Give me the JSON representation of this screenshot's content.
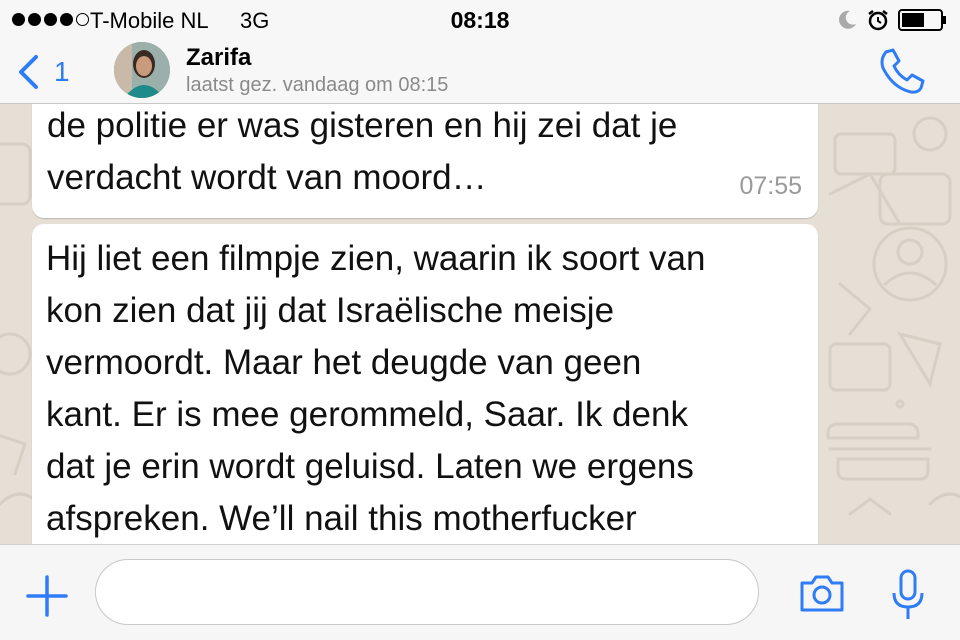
{
  "status_bar": {
    "signal_bars": 4,
    "signal_total": 5,
    "carrier": "T-Mobile NL",
    "network": "3G",
    "time": "08:18",
    "icons": [
      "moon-icon",
      "alarm-icon",
      "battery-icon"
    ]
  },
  "header": {
    "back_count": "1",
    "contact_name": "Zarifa",
    "last_seen": "laatst gez. vandaag om 08:15",
    "icons": [
      "chevron-left-icon",
      "avatar",
      "phone-icon"
    ]
  },
  "messages": [
    {
      "lines": [
        "de politie er was gisteren en hij zei dat je",
        "verdacht wordt van moord…"
      ],
      "time": "07:55"
    },
    {
      "lines": [
        "Hij liet een filmpje zien, waarin ik soort van",
        "kon zien dat jij dat Israëlische meisje",
        "vermoordt. Maar het deugde van geen",
        "kant. Er is mee gerommeld, Saar. Ik denk",
        "dat je erin wordt geluisd. Laten we ergens",
        "afspreken. We’ll nail this motherfucker"
      ]
    }
  ],
  "input_bar": {
    "message_value": "",
    "icons": [
      "plus-icon",
      "camera-icon",
      "microphone-icon"
    ]
  },
  "colors": {
    "accent": "#2e7cf6",
    "wallpaper": "#e6dfd6",
    "bubble": "#ffffff",
    "bar": "#f7f7f7"
  }
}
